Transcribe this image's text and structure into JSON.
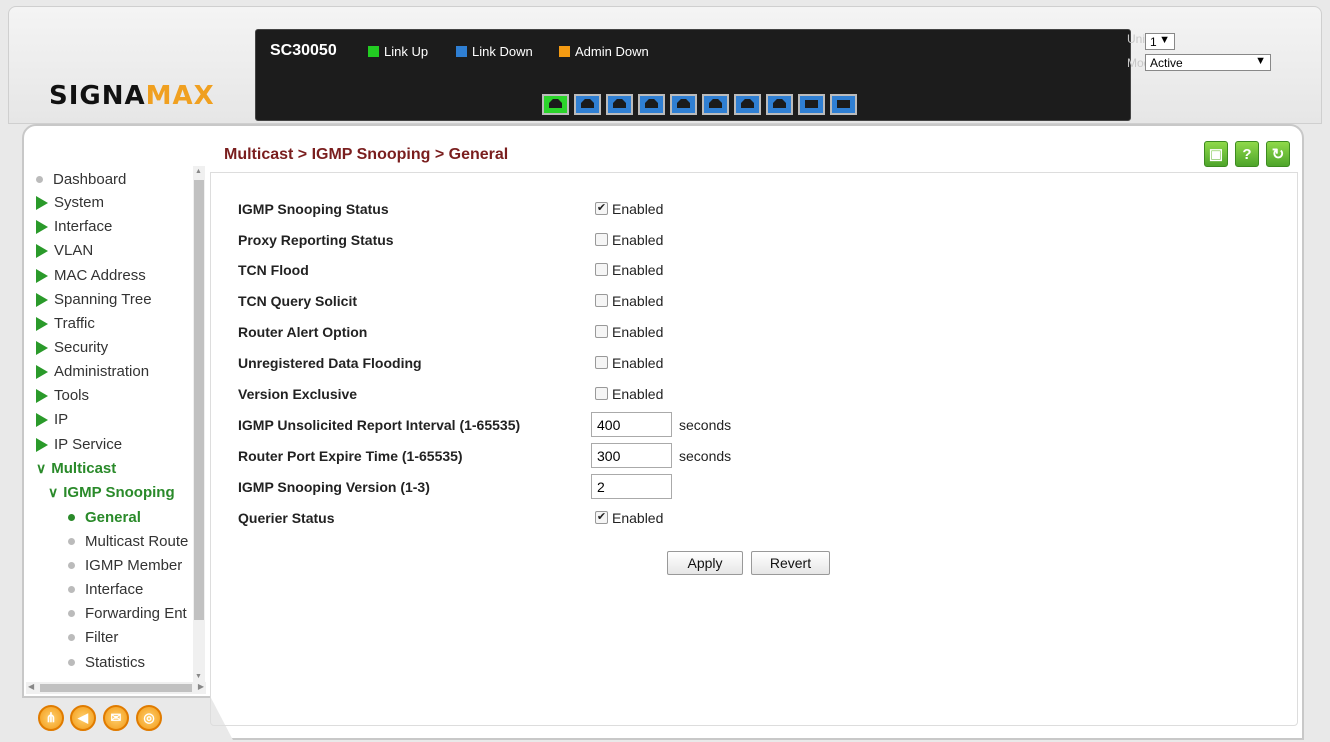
{
  "header": {
    "logo_main": "SIGNA",
    "logo_accent": "MAX",
    "model": "SC30050",
    "legend": [
      {
        "label": "Link Up",
        "color": "#22cc22"
      },
      {
        "label": "Link Down",
        "color": "#2f7fd3"
      },
      {
        "label": "Admin Down",
        "color": "#f39a12"
      }
    ],
    "ports": [
      {
        "state": "up"
      },
      {
        "state": "down"
      },
      {
        "state": "down"
      },
      {
        "state": "down"
      },
      {
        "state": "down"
      },
      {
        "state": "down"
      },
      {
        "state": "down"
      },
      {
        "state": "down"
      },
      {
        "state": "sfp-down"
      },
      {
        "state": "sfp-down"
      }
    ],
    "unit_label": "Unit",
    "unit_value": "1",
    "mode_label": "Mode",
    "mode_value": "Active"
  },
  "sidebar": {
    "items": [
      {
        "label": "Dashboard",
        "icon": "dot"
      },
      {
        "label": "System",
        "icon": "chevron-right"
      },
      {
        "label": "Interface",
        "icon": "chevron-right"
      },
      {
        "label": "VLAN",
        "icon": "chevron-right"
      },
      {
        "label": "MAC Address",
        "icon": "chevron-right"
      },
      {
        "label": "Spanning Tree",
        "icon": "chevron-right"
      },
      {
        "label": "Traffic",
        "icon": "chevron-right"
      },
      {
        "label": "Security",
        "icon": "chevron-right"
      },
      {
        "label": "Administration",
        "icon": "chevron-right"
      },
      {
        "label": "Tools",
        "icon": "chevron-right"
      },
      {
        "label": "IP",
        "icon": "chevron-right"
      },
      {
        "label": "IP Service",
        "icon": "chevron-right"
      },
      {
        "label": "Multicast",
        "icon": "chevron-down"
      },
      {
        "label": "IGMP Snooping",
        "icon": "chevron-down"
      },
      {
        "label": "General",
        "icon": "dot"
      },
      {
        "label": "Multicast Route",
        "icon": "dot"
      },
      {
        "label": "IGMP Member",
        "icon": "dot"
      },
      {
        "label": "Interface",
        "icon": "dot"
      },
      {
        "label": "Forwarding Ent",
        "icon": "dot"
      },
      {
        "label": "Filter",
        "icon": "dot"
      },
      {
        "label": "Statistics",
        "icon": "dot"
      }
    ]
  },
  "breadcrumb": "Multicast > IGMP Snooping > General",
  "toolbar_icons": [
    "save-icon",
    "help-icon",
    "refresh-icon"
  ],
  "form": {
    "fields": [
      {
        "label": "IGMP Snooping Status",
        "type": "checkbox",
        "checked": true,
        "option": "Enabled"
      },
      {
        "label": "Proxy Reporting Status",
        "type": "checkbox",
        "checked": false,
        "option": "Enabled"
      },
      {
        "label": "TCN Flood",
        "type": "checkbox",
        "checked": false,
        "option": "Enabled"
      },
      {
        "label": "TCN Query Solicit",
        "type": "checkbox",
        "checked": false,
        "option": "Enabled"
      },
      {
        "label": "Router Alert Option",
        "type": "checkbox",
        "checked": false,
        "option": "Enabled"
      },
      {
        "label": "Unregistered Data Flooding",
        "type": "checkbox",
        "checked": false,
        "option": "Enabled"
      },
      {
        "label": "Version Exclusive",
        "type": "checkbox",
        "checked": false,
        "option": "Enabled"
      },
      {
        "label": "IGMP Unsolicited Report Interval (1-65535)",
        "type": "text",
        "value": "400",
        "unit": "seconds"
      },
      {
        "label": "Router Port Expire Time (1-65535)",
        "type": "text",
        "value": "300",
        "unit": "seconds"
      },
      {
        "label": "IGMP Snooping Version (1-3)",
        "type": "text",
        "value": "2",
        "unit": ""
      },
      {
        "label": "Querier Status",
        "type": "checkbox",
        "checked": true,
        "option": "Enabled"
      }
    ],
    "apply_label": "Apply",
    "revert_label": "Revert"
  },
  "footer_icons": [
    "sitemap-icon",
    "bookmark-icon",
    "mail-icon",
    "globe-icon"
  ]
}
